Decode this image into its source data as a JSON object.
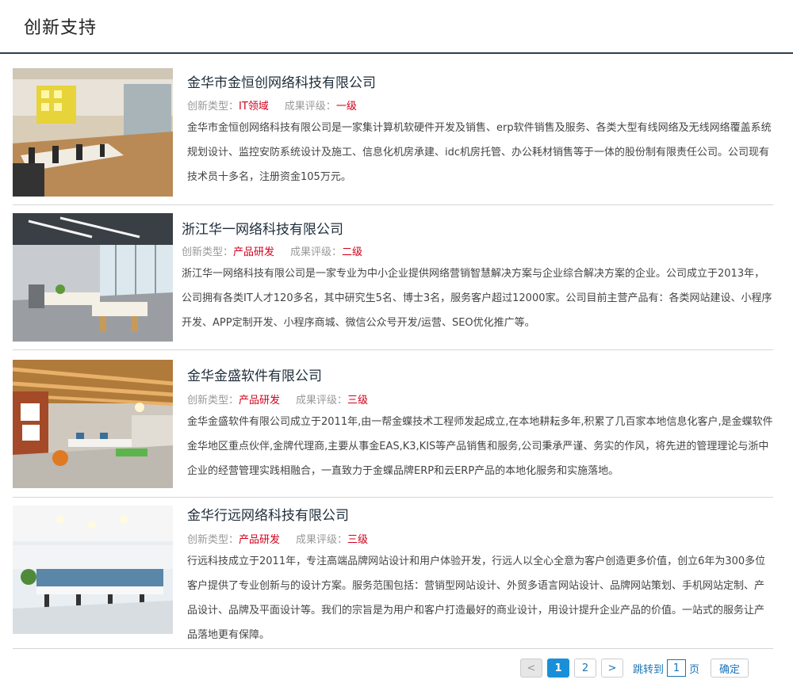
{
  "header": {
    "title": "创新支持"
  },
  "labels": {
    "type": "创新类型：",
    "grade": "成果评级："
  },
  "items": [
    {
      "title": "金华市金恒创网络科技有限公司",
      "type": "IT领域",
      "grade": "一级",
      "description": "金华市金恒创网络科技有限公司是一家集计算机软硬件开发及销售、erp软件销售及服务、各类大型有线网络及无线网络覆盖系统规划设计、监控安防系统设计及施工、信息化机房承建、idc机房托管、办公耗材销售等于一体的股份制有限责任公司。公司现有技术员十多名，注册资金105万元。"
    },
    {
      "title": "浙江华一网络科技有限公司",
      "type": "产品研发",
      "grade": "二级",
      "description": "浙江华一网络科技有限公司是一家专业为中小企业提供网络营销智慧解决方案与企业综合解决方案的企业。公司成立于2013年，公司拥有各类IT人才120多名，其中研究生5名、博士3名，服务客户超过12000家。公司目前主营产品有：各类网站建设、小程序开发、APP定制开发、小程序商城、微信公众号开发/运营、SEO优化推广等。"
    },
    {
      "title": "金华金盛软件有限公司",
      "type": "产品研发",
      "grade": "三级",
      "description": "金华金盛软件有限公司成立于2011年,由一帮金蝶技术工程师发起成立,在本地耕耘多年,积累了几百家本地信息化客户,是金蝶软件金华地区重点伙伴,金牌代理商,主要从事金EAS,K3,KIS等产品销售和服务,公司秉承严谨、务实的作风，将先进的管理理论与浙中企业的经营管理实践相融合，一直致力于金蝶品牌ERP和云ERP产品的本地化服务和实施落地。"
    },
    {
      "title": "金华行远网络科技有限公司",
      "type": "产品研发",
      "grade": "三级",
      "description": "行远科技成立于2011年，专注高端品牌网站设计和用户体验开发，行远人以全心全意为客户创造更多价值，创立6年为300多位客户提供了专业创新与的设计方案。服务范围包括：营销型网站设计、外贸多语言网站设计、品牌网站策划、手机网站定制、产品设计、品牌及平面设计等。我们的宗旨是为用户和客户打造最好的商业设计，用设计提升企业产品的价值。一站式的服务让产品落地更有保障。"
    }
  ],
  "pagination": {
    "prev": "<",
    "pages": [
      "1",
      "2"
    ],
    "next": ">",
    "jump_label": "跳转到",
    "jump_value": "1",
    "page_unit": "页",
    "confirm": "确定"
  }
}
